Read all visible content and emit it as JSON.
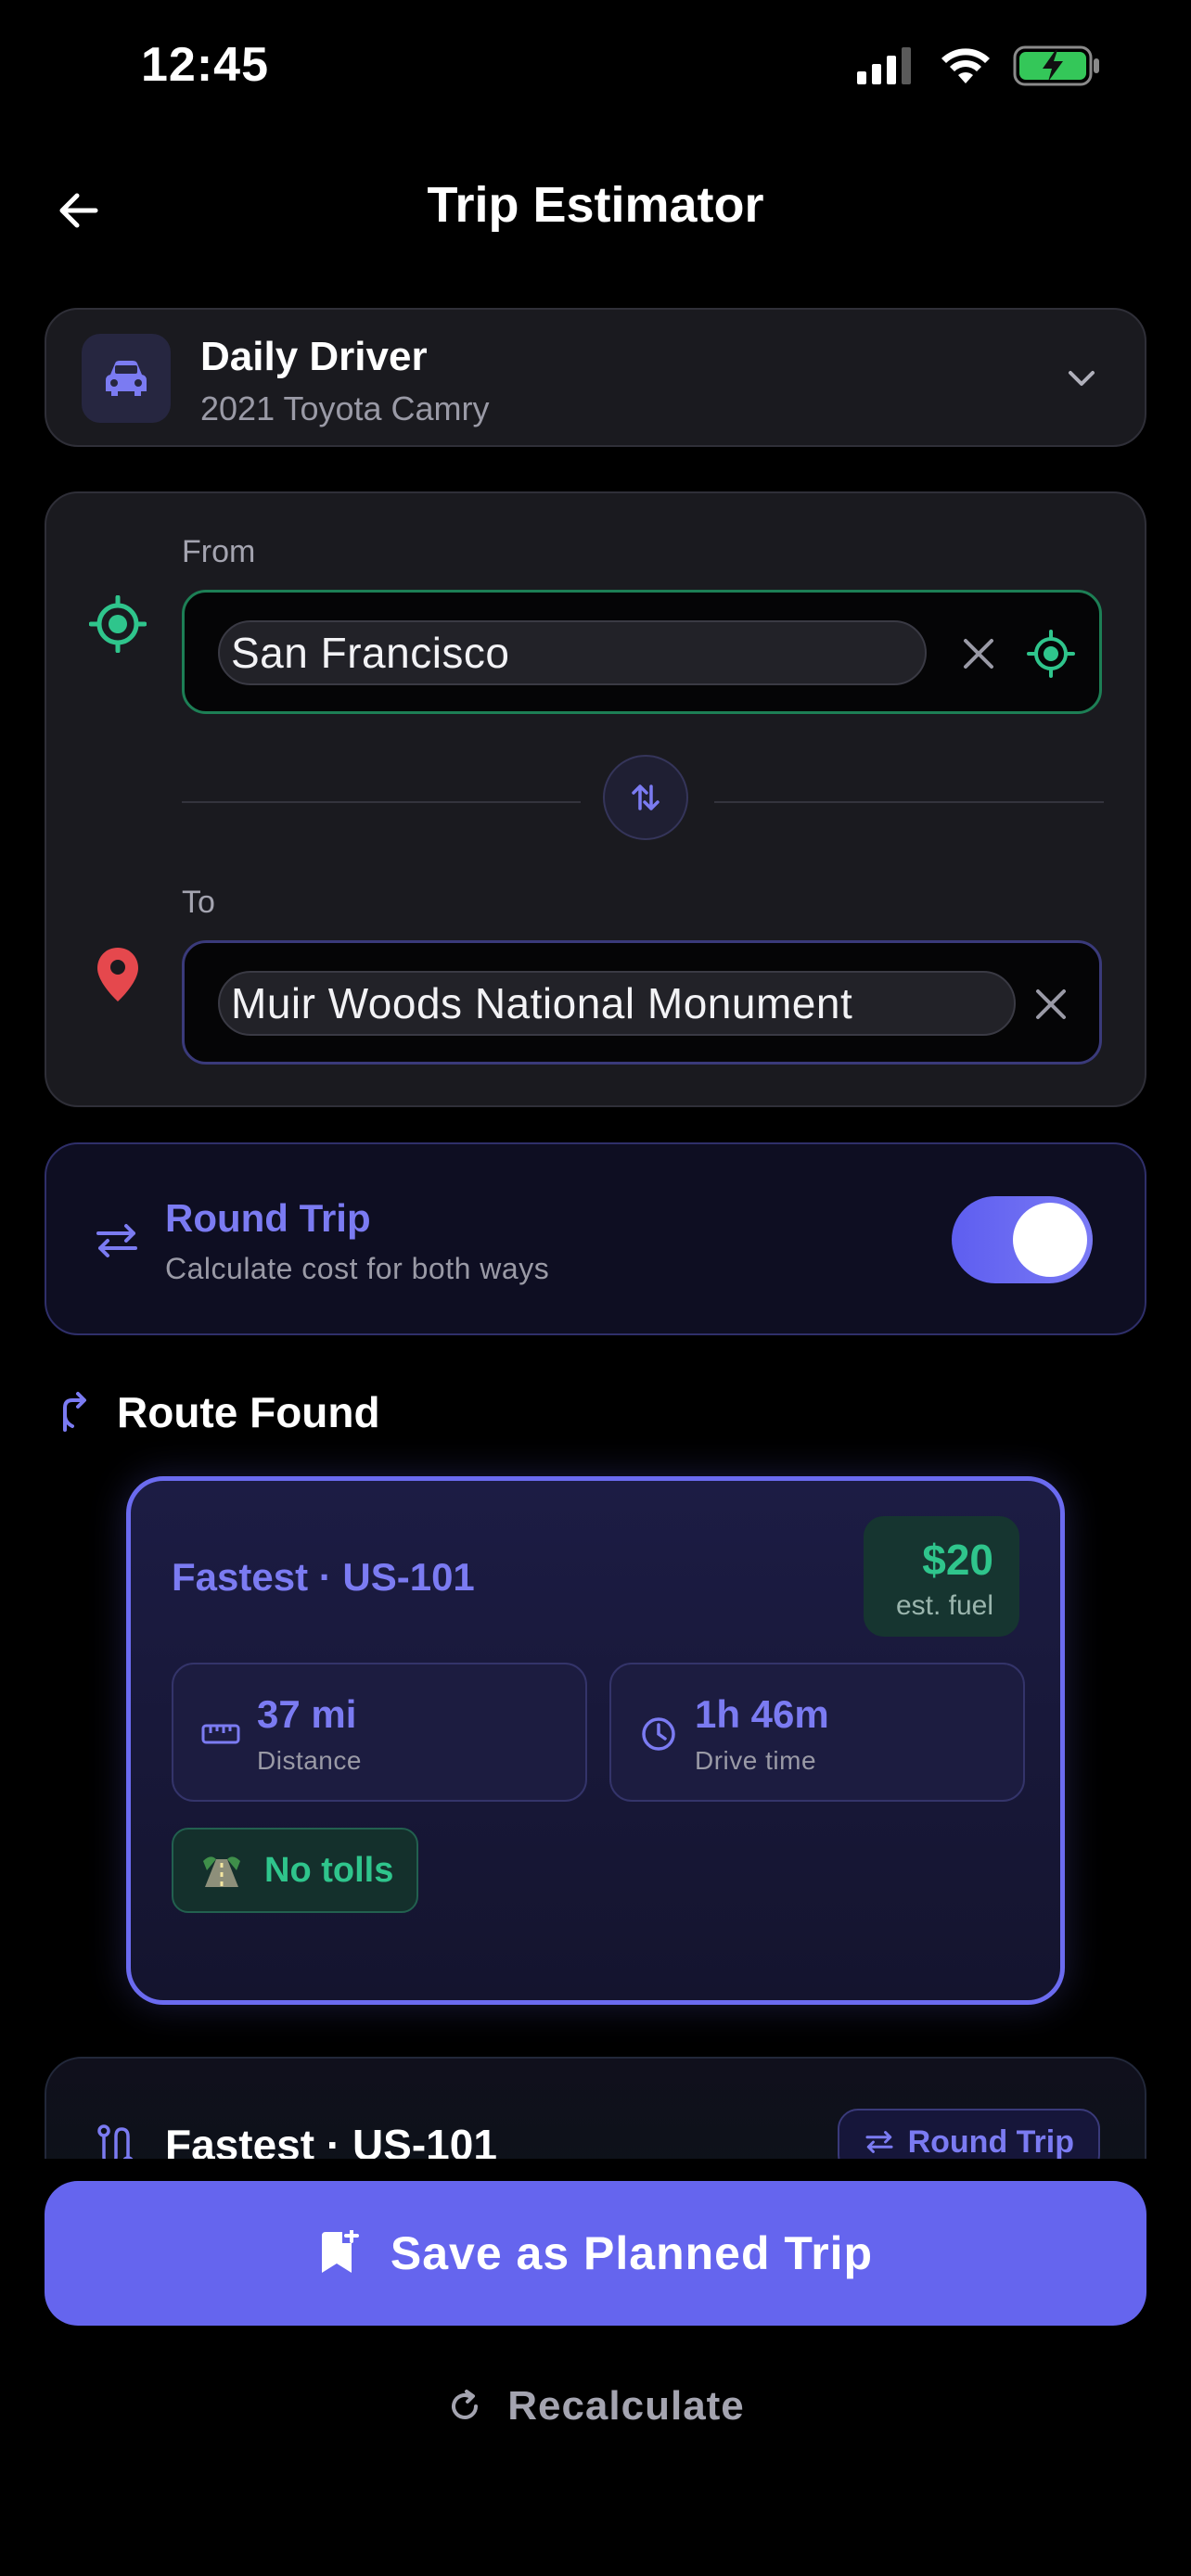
{
  "status_bar": {
    "time": "12:45"
  },
  "nav": {
    "title": "Trip Estimator",
    "back_icon": "arrow-left-icon"
  },
  "vehicle": {
    "name": "Daily Driver",
    "model": "2021 Toyota Camry",
    "icon": "car-icon"
  },
  "locations": {
    "from_label": "From",
    "from_value": "San Francisco",
    "to_label": "To",
    "to_value": "Muir Woods National Monument"
  },
  "round_trip": {
    "title": "Round Trip",
    "subtitle": "Calculate cost for both ways",
    "enabled": true
  },
  "route": {
    "header": "Route Found",
    "title": "Fastest · US-101",
    "price": "$20",
    "price_label": "est. fuel",
    "distance_value": "37 mi",
    "distance_label": "Distance",
    "time_value": "1h 46m",
    "time_label": "Drive time",
    "tolls": "No tolls"
  },
  "summary": {
    "title": "Fastest · US-101",
    "badge": "Round Trip"
  },
  "actions": {
    "save": "Save as Planned Trip",
    "recalculate": "Recalculate"
  },
  "colors": {
    "accent": "#6565ee",
    "green": "#2fc58c",
    "red": "#e5484d",
    "background": "#000000"
  }
}
